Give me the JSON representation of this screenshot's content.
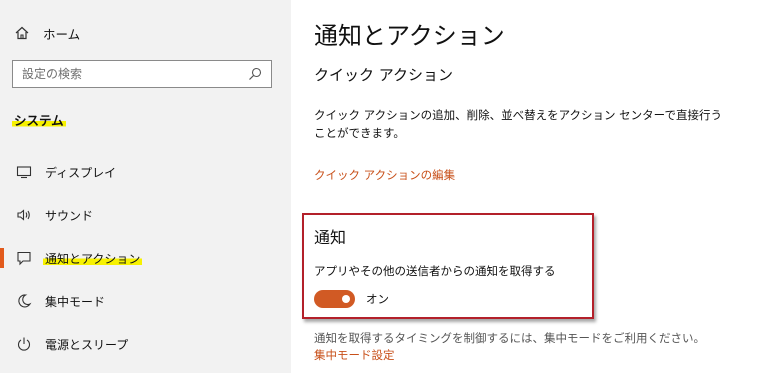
{
  "sidebar": {
    "home_label": "ホーム",
    "search_placeholder": "設定の検索",
    "section_label": "システム",
    "items": [
      {
        "label": "ディスプレイ",
        "icon": "monitor-icon"
      },
      {
        "label": "サウンド",
        "icon": "speaker-icon"
      },
      {
        "label": "通知とアクション",
        "icon": "notification-icon",
        "selected": true
      },
      {
        "label": "集中モード",
        "icon": "moon-icon"
      },
      {
        "label": "電源とスリープ",
        "icon": "power-icon"
      }
    ]
  },
  "main": {
    "title": "通知とアクション",
    "quick_actions": {
      "heading": "クイック アクション",
      "description": "クイック アクションの追加、削除、並べ替えをアクション センターで直接行うことができます。",
      "edit_link": "クイック アクションの編集"
    },
    "notifications": {
      "heading": "通知",
      "toggle_description": "アプリやその他の送信者からの通知を取得する",
      "toggle_state": "オン",
      "toggle_on": true
    },
    "focus": {
      "description": "通知を取得するタイミングを制御するには、集中モードをご利用ください。",
      "link": "集中モード設定"
    }
  },
  "colors": {
    "accent": "#d15a24",
    "link": "#c8501a",
    "highlight": "#f7f200",
    "annotation_border": "#b3202a",
    "sidebar_bg": "#f2f2f2"
  }
}
